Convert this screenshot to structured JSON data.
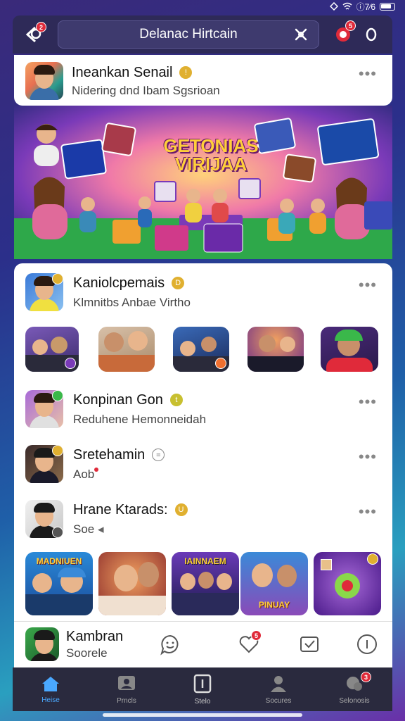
{
  "status": {
    "time": "ⓘ7⁄6"
  },
  "topbar": {
    "search_text": "Delanac Hirtcain",
    "badge_left": "2",
    "badge_right": "5"
  },
  "post_top": {
    "name": "Ineankan Senail",
    "sub": "Nidering dnd Ibam Sgsrioan"
  },
  "banner": {
    "title_line1": "GETONIAS",
    "title_line2": "VIRIJAA"
  },
  "group": {
    "name": "Kaniolcpemais",
    "sub": "Klmnitbs   Anbae Virtho"
  },
  "people": [
    {
      "name": "Konpinan Gon",
      "sub": "Reduhene Hemonneidah"
    },
    {
      "name": "Sretehamin",
      "sub": "Aob"
    },
    {
      "name": "Hrane Ktarads:",
      "sub": "Soe"
    }
  ],
  "tiles": [
    {
      "caption": "MADNIUEN"
    },
    {
      "caption": ""
    },
    {
      "caption": "IAINNAEM"
    },
    {
      "caption": "PINUAY"
    },
    {
      "caption": ""
    }
  ],
  "bottom_card": {
    "name": "Kambran",
    "sub": "Soorele",
    "badge": "5"
  },
  "nav": [
    {
      "label": "Heise",
      "icon": "home-icon"
    },
    {
      "label": "Prncls",
      "icon": "profile-card-icon"
    },
    {
      "label": "Stelo",
      "icon": "story-icon"
    },
    {
      "label": "Socures",
      "icon": "person-icon"
    },
    {
      "label": "Selonosis",
      "icon": "chat-icon"
    }
  ],
  "nav_badge": "3",
  "colors": {
    "accent": "#4aa8ff",
    "badge": "#e02a3a",
    "topbar": "#2e2a58"
  }
}
